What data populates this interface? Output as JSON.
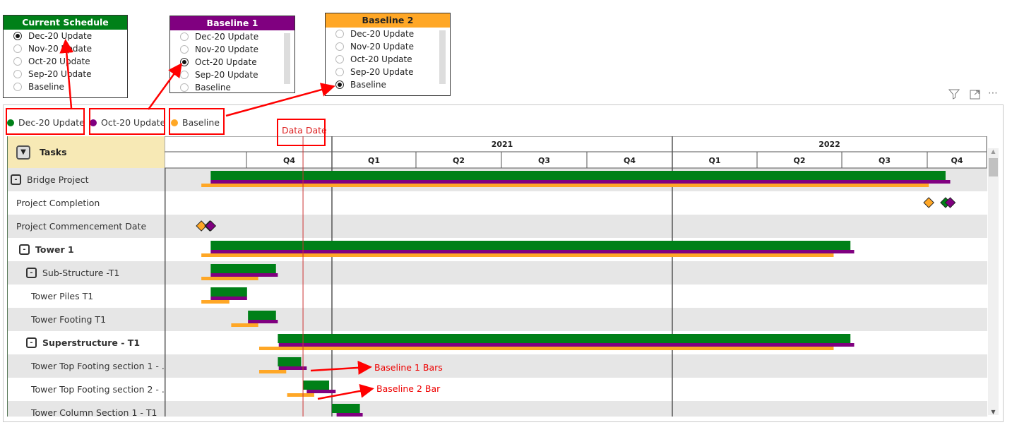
{
  "slicers": [
    {
      "title": "Current Schedule",
      "header_color": "#008018",
      "title_color": "#ffffff",
      "options": [
        "Dec-20 Update",
        "Nov-20 Update",
        "Oct-20 Update",
        "Sep-20 Update",
        "Baseline"
      ],
      "selected": 0
    },
    {
      "title": "Baseline 1",
      "header_color": "#800080",
      "title_color": "#ffffff",
      "options": [
        "Dec-20 Update",
        "Nov-20 Update",
        "Oct-20 Update",
        "Sep-20 Update",
        "Baseline"
      ],
      "selected": 2
    },
    {
      "title": "Baseline 2",
      "header_color": "#ffa726",
      "title_color": "#222222",
      "options": [
        "Dec-20 Update",
        "Nov-20 Update",
        "Oct-20 Update",
        "Sep-20 Update",
        "Baseline"
      ],
      "selected": 4
    }
  ],
  "legend": [
    {
      "label": "Dec-20 Update",
      "color": "#008018"
    },
    {
      "label": "Oct-20 Update",
      "color": "#800080"
    },
    {
      "label": "Baseline",
      "color": "#ffa726"
    }
  ],
  "annotations": {
    "data_date": "Data Date",
    "baseline1_bars": "Baseline 1 Bars",
    "baseline2_bar": "Baseline 2 Bar"
  },
  "toolbar_icons": [
    "filter-icon",
    "focus-mode-icon",
    "more-options-icon"
  ],
  "gantt": {
    "tasks_header": "Tasks",
    "years": [
      {
        "label": "2021"
      },
      {
        "label": "2022"
      }
    ],
    "quarters": [
      "",
      "Q4",
      "Q1",
      "Q2",
      "Q3",
      "Q4",
      "Q1",
      "Q2",
      "Q3",
      "Q4"
    ],
    "data_date": "2020-12-01",
    "rows": [
      {
        "name": "Bridge Project",
        "level": 0,
        "group": true,
        "bold": false,
        "current": [
          "2020-08-24",
          "2022-10-21"
        ],
        "baseline1": [
          "2020-08-24",
          "2022-10-26"
        ],
        "baseline2": [
          "2020-08-14",
          "2022-10-03"
        ]
      },
      {
        "name": "Project Completion",
        "level": 0,
        "milestone": true,
        "current": "2022-10-21",
        "baseline1": "2022-10-26",
        "baseline2": "2022-10-03"
      },
      {
        "name": "Project Commencement Date",
        "level": 0,
        "milestone": true,
        "current": "2020-08-23",
        "baseline1": "2020-08-24",
        "baseline2": "2020-08-14"
      },
      {
        "name": "Tower 1",
        "level": 1,
        "group": true,
        "bold": true,
        "current": [
          "2020-08-24",
          "2022-07-11"
        ],
        "baseline1": [
          "2020-08-24",
          "2022-07-15"
        ],
        "baseline2": [
          "2020-08-14",
          "2022-06-23"
        ]
      },
      {
        "name": "Sub-Structure -T1",
        "level": 2,
        "group": true,
        "bold": false,
        "current": [
          "2020-08-24",
          "2020-11-02"
        ],
        "baseline1": [
          "2020-08-24",
          "2020-11-04"
        ],
        "baseline2": [
          "2020-08-14",
          "2020-10-14"
        ]
      },
      {
        "name": "Tower Piles T1",
        "level": 3,
        "current": [
          "2020-08-24",
          "2020-10-02"
        ],
        "baseline1": [
          "2020-08-24",
          "2020-10-02"
        ],
        "baseline2": [
          "2020-08-14",
          "2020-09-13"
        ]
      },
      {
        "name": "Tower Footing T1",
        "level": 3,
        "current": [
          "2020-10-03",
          "2020-11-02"
        ],
        "baseline1": [
          "2020-10-03",
          "2020-11-04"
        ],
        "baseline2": [
          "2020-09-15",
          "2020-10-14"
        ]
      },
      {
        "name": "Superstructure - T1",
        "level": 2,
        "group": true,
        "bold": true,
        "current": [
          "2020-11-04",
          "2022-07-11"
        ],
        "baseline1": [
          "2020-11-05",
          "2022-07-15"
        ],
        "baseline2": [
          "2020-10-15",
          "2022-06-23"
        ]
      },
      {
        "name": "Tower Top Footing section 1 - ...",
        "level": 3,
        "current": [
          "2020-11-04",
          "2020-11-29"
        ],
        "baseline1": [
          "2020-11-05",
          "2020-12-05"
        ],
        "baseline2": [
          "2020-10-15",
          "2020-11-13"
        ]
      },
      {
        "name": "Tower Top Footing section 2 - ...",
        "level": 3,
        "current": [
          "2020-12-01",
          "2020-12-29"
        ],
        "baseline1": [
          "2020-12-05",
          "2021-01-05"
        ],
        "baseline2": [
          "2020-11-14",
          "2020-12-13"
        ]
      },
      {
        "name": "Tower Column Section 1 - T1",
        "level": 3,
        "current": [
          "2021-01-01",
          "2021-01-31"
        ],
        "baseline1": [
          "2021-01-06",
          "2021-02-03"
        ],
        "baseline2": null
      }
    ]
  }
}
